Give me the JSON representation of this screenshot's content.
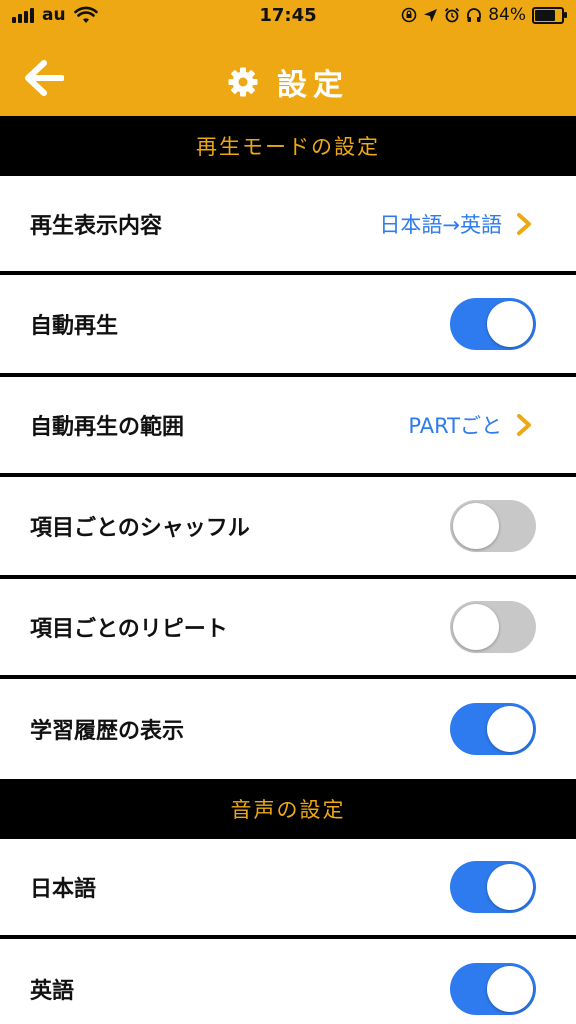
{
  "status_bar": {
    "carrier": "au",
    "time": "17:45",
    "battery_percent": "84%",
    "battery_level": 0.84
  },
  "header": {
    "title": "設定",
    "back_icon": "arrow-left-icon",
    "title_icon": "gear-icon",
    "bg_color": "#EDA814"
  },
  "sections": [
    {
      "title": "再生モードの設定",
      "rows": [
        {
          "label": "再生表示内容",
          "type": "value",
          "value": "日本語→英語"
        },
        {
          "label": "自動再生",
          "type": "toggle",
          "on": true
        },
        {
          "label": "自動再生の範囲",
          "type": "value",
          "value": "PARTごと"
        },
        {
          "label": "項目ごとのシャッフル",
          "type": "toggle",
          "on": false
        },
        {
          "label": "項目ごとのリピート",
          "type": "toggle",
          "on": false
        },
        {
          "label": "学習履歴の表示",
          "type": "toggle",
          "on": true
        }
      ]
    },
    {
      "title": "音声の設定",
      "rows": [
        {
          "label": "日本語",
          "type": "toggle",
          "on": true
        },
        {
          "label": "英語",
          "type": "toggle",
          "on": true
        }
      ]
    }
  ],
  "colors": {
    "accent": "#EDA814",
    "toggle_on": "#2D7BEF",
    "toggle_off": "#C8C8C8",
    "value_text": "#2D7BEF"
  }
}
